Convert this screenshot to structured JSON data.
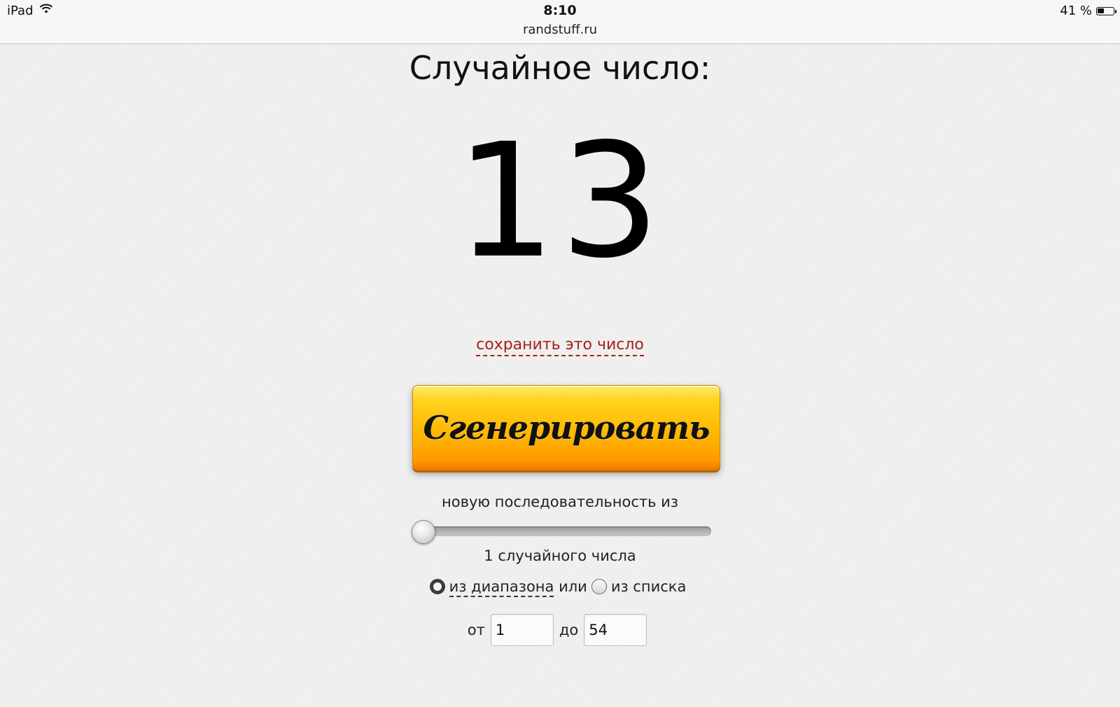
{
  "status_bar": {
    "device": "iPad",
    "time": "8:10",
    "battery": "41 %",
    "battery_level": 0.41,
    "icons": [
      "wifi-icon",
      "battery-icon"
    ]
  },
  "address_bar": {
    "url": "randstuff.ru"
  },
  "main": {
    "title": "Случайное число:",
    "number": "13",
    "save_link": "сохранить это число",
    "generate_button": "Сгенерировать",
    "sequence_label": "новую последовательность из",
    "slider_value": 1,
    "count_label": "1 случайного числа",
    "radio_range_label": "из диапазона",
    "radio_or": "или",
    "radio_list_label": "из списка",
    "selected_mode": "range",
    "from_label": "от",
    "from_value": "1",
    "to_label": "до",
    "to_value": "54"
  },
  "colors": {
    "link": "#a8201a",
    "button_top": "#ffe96a",
    "button_bottom": "#ff9a00",
    "background": "#efefef"
  }
}
